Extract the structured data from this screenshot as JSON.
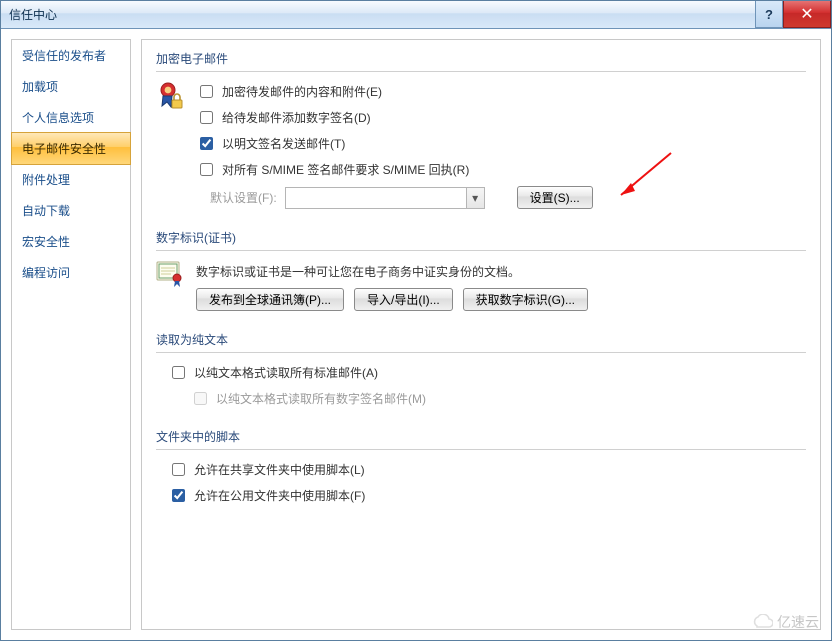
{
  "window": {
    "title": "信任中心",
    "help": "?",
    "close": "✕"
  },
  "sidebar": {
    "items": [
      {
        "label": "受信任的发布者"
      },
      {
        "label": "加载项"
      },
      {
        "label": "个人信息选项"
      },
      {
        "label": "电子邮件安全性"
      },
      {
        "label": "附件处理"
      },
      {
        "label": "自动下载"
      },
      {
        "label": "宏安全性"
      },
      {
        "label": "编程访问"
      }
    ],
    "selected_index": 3
  },
  "sections": {
    "encrypt": {
      "header": "加密电子邮件",
      "opts": [
        {
          "label": "加密待发邮件的内容和附件(E)",
          "checked": false
        },
        {
          "label": "给待发邮件添加数字签名(D)",
          "checked": false
        },
        {
          "label": "以明文签名发送邮件(T)",
          "checked": true
        },
        {
          "label": "对所有 S/MIME 签名邮件要求 S/MIME 回执(R)",
          "checked": false
        }
      ],
      "default_label": "默认设置(F):",
      "default_value": "",
      "settings_btn": "设置(S)..."
    },
    "cert": {
      "header": "数字标识(证书)",
      "desc": "数字标识或证书是一种可让您在电子商务中证实身份的文档。",
      "buttons": {
        "publish": "发布到全球通讯簿(P)...",
        "import": "导入/导出(I)...",
        "get": "获取数字标识(G)..."
      }
    },
    "plain": {
      "header": "读取为纯文本",
      "opts": [
        {
          "label": "以纯文本格式读取所有标准邮件(A)",
          "checked": false,
          "disabled": false
        },
        {
          "label": "以纯文本格式读取所有数字签名邮件(M)",
          "checked": false,
          "disabled": true
        }
      ]
    },
    "scripts": {
      "header": "文件夹中的脚本",
      "opts": [
        {
          "label": "允许在共享文件夹中使用脚本(L)",
          "checked": false
        },
        {
          "label": "允许在公用文件夹中使用脚本(F)",
          "checked": true
        }
      ]
    }
  },
  "watermark": "亿速云"
}
